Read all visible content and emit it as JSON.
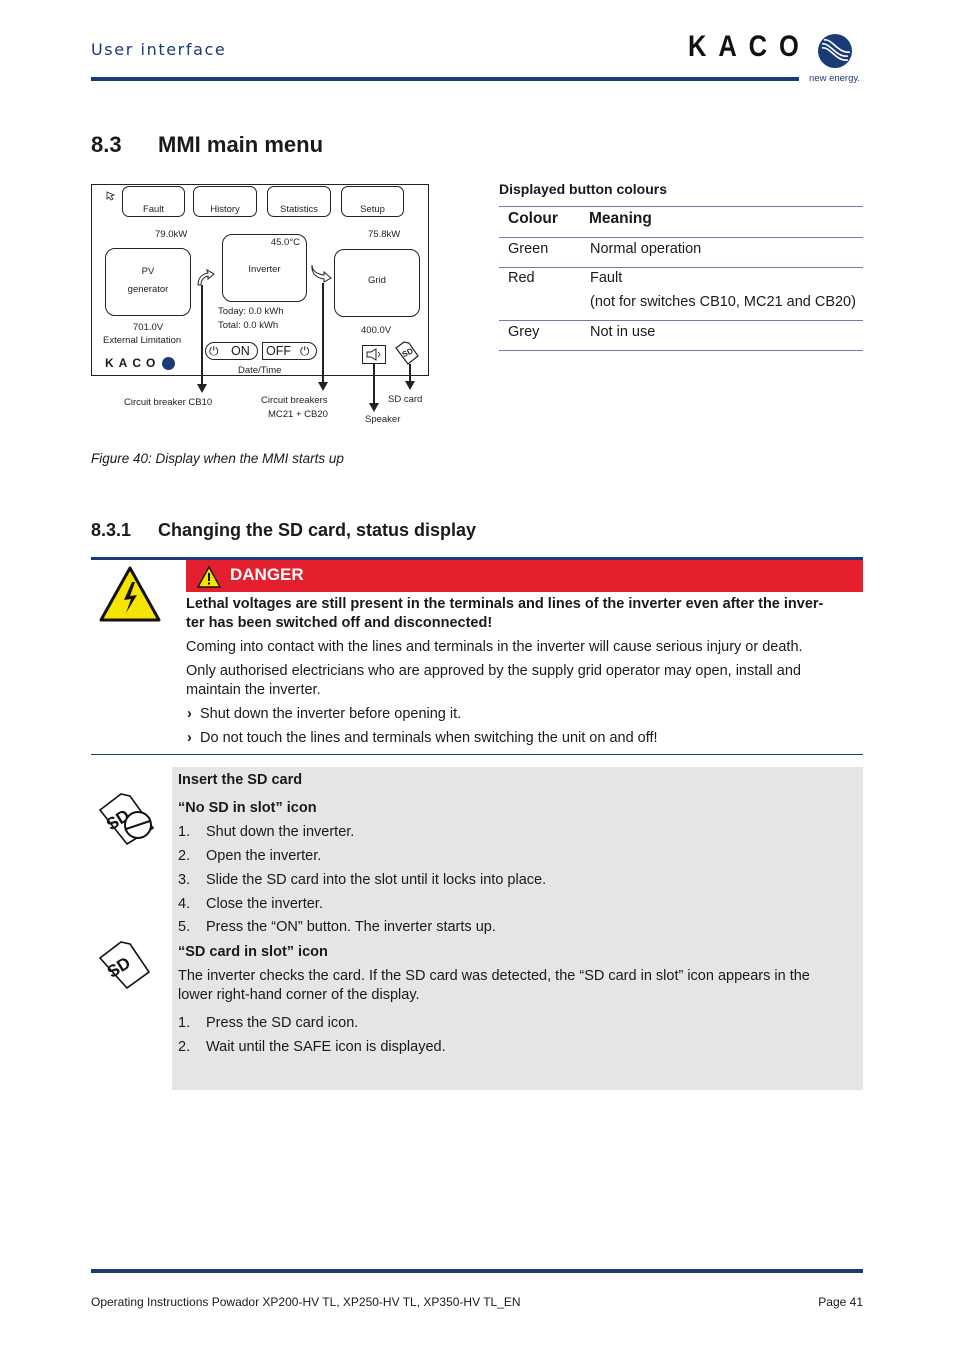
{
  "header": {
    "section_title": "User interface",
    "logo_text": "KACO",
    "logo_tagline": "new energy."
  },
  "section": {
    "number": "8.3",
    "title": "MMI main menu"
  },
  "figure": {
    "menu_buttons": [
      "Fault",
      "History",
      "Statistics",
      "Setup"
    ],
    "pv_power": "79.0kW",
    "grid_power": "75.8kW",
    "pv_label_line1": "PV",
    "pv_label_line2": "generator",
    "inverter_label": "Inverter",
    "inverter_temp": "45.0°C",
    "grid_label": "Grid",
    "today": "Today: 0.0 kWh",
    "total": "Total: 0.0 kWh",
    "pv_voltage": "701.0V",
    "external_limitation": "External Limitation",
    "grid_voltage": "400.0V",
    "on_label": "ON",
    "off_label": "OFF",
    "date_time": "Date/Time",
    "screen_logo": "KACO",
    "sd_icon_text": "SD",
    "callouts": {
      "cb10": "Circuit breaker CB10",
      "mc21_line1": "Circuit breakers",
      "mc21_line2": "MC21 + CB20",
      "speaker": "Speaker",
      "sd_card": "SD card"
    },
    "caption": "Figure 40: Display when the MMI starts up"
  },
  "colour_table": {
    "title": "Displayed button colours",
    "headers": [
      "Colour",
      "Meaning"
    ],
    "rows": [
      {
        "colour": "Green",
        "meaning": "Normal operation",
        "note": ""
      },
      {
        "colour": "Red",
        "meaning": "Fault",
        "note": "(not for switches CB10, MC21 and CB20)"
      },
      {
        "colour": "Grey",
        "meaning": "Not in use",
        "note": ""
      }
    ]
  },
  "subsection": {
    "number": "8.3.1",
    "title": "Changing the SD card, status display"
  },
  "danger": {
    "label": "DANGER",
    "bold_line1": "Lethal voltages are still present in the terminals and lines of the inverter even after the inver-",
    "bold_line2": "ter has been switched off and disconnected!",
    "para1": "Coming into contact with the lines and terminals in the inverter will cause serious injury or death.",
    "para2_line1": "Only authorised electricians who are approved by the supply grid operator may open, install and",
    "para2_line2": "maintain the inverter.",
    "bullets": [
      "Shut down the inverter before opening it.",
      "Do not touch the lines and terminals when switching the unit on and off!"
    ],
    "bullet_glyph": "›"
  },
  "sd_box": {
    "title": "Insert the SD card",
    "no_sd_heading": "“No SD in slot” icon",
    "no_sd_steps": [
      "Shut down the inverter.",
      "Open the inverter.",
      "Slide the SD card into the slot until it locks into place.",
      "Close the inverter.",
      "Press the “ON” button. The inverter starts up."
    ],
    "sd_in_heading": "“SD card in slot” icon",
    "sd_in_para_line1": "The inverter checks the card. If the SD card was detected, the “SD card in slot” icon appears in the",
    "sd_in_para_line2": "lower right-hand corner of the display.",
    "sd_in_steps": [
      "Press the SD card icon.",
      "Wait until the SAFE icon is displayed."
    ]
  },
  "footer": {
    "doc_title": "Operating Instructions Powador XP200-HV TL, XP250-HV TL, XP350-HV TL_EN",
    "page": "Page 41"
  }
}
